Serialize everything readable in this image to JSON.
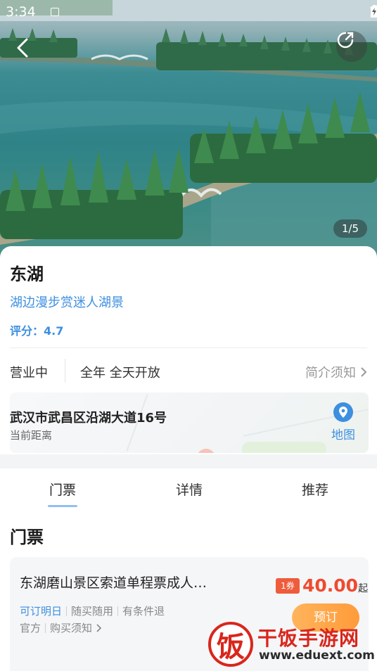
{
  "status_bar": {
    "time": "3:34"
  },
  "hero": {
    "pager": "1/5"
  },
  "info": {
    "title": "东湖",
    "slogan": "湖边漫步赏迷人湖景",
    "rating": "评分：4.7",
    "open_status": "营业中",
    "open_hours": "全年 全天开放",
    "intro_link": "简介须知",
    "address": "武汉市武昌区沿湖大道16号",
    "distance_label": "当前距离",
    "map_label": "地图"
  },
  "tabs": [
    {
      "label": "门票"
    },
    {
      "label": "详情"
    },
    {
      "label": "推荐"
    }
  ],
  "section_title": "门票",
  "ticket": {
    "name": "东湖磨山景区索道单程票成人…",
    "coupon": "1券",
    "price": "40.00",
    "price_unit": "起",
    "tags": [
      "可订明日",
      "随买随用",
      "有条件退"
    ],
    "tags2": [
      "官方",
      "购买须知"
    ],
    "book_label": "预订"
  },
  "watermark": {
    "logo_char": "饭",
    "title": "干饭手游网",
    "url": "www.eduext.com"
  },
  "colors": {
    "accent": "#3d8fe0",
    "price": "#ef4a2f",
    "book": "#ff9b3a"
  }
}
